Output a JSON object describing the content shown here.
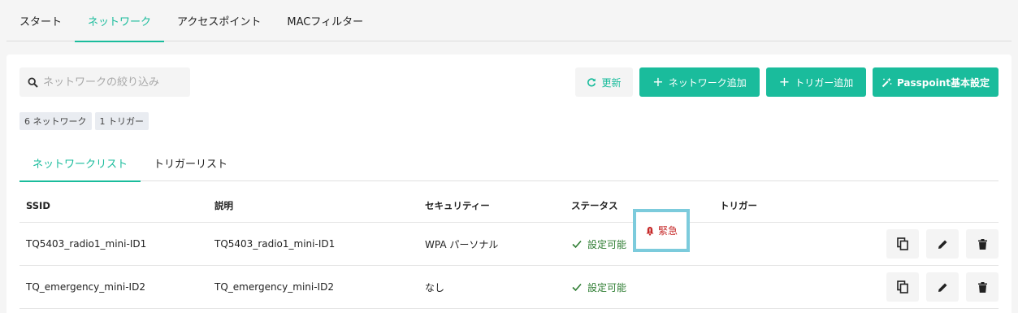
{
  "top_tabs": [
    "スタート",
    "ネットワーク",
    "アクセスポイント",
    "MACフィルター"
  ],
  "search": {
    "placeholder": "ネットワークの絞り込み"
  },
  "toolbar": {
    "refresh_label": "更新",
    "add_network_label": "ネットワーク追加",
    "add_trigger_label": "トリガー追加",
    "passpoint_label": "Passpoint基本設定"
  },
  "badges": {
    "networks": "6 ネットワーク",
    "triggers": "1 トリガー"
  },
  "sub_tabs": [
    "ネットワークリスト",
    "トリガーリスト"
  ],
  "table": {
    "columns": [
      "SSID",
      "説明",
      "セキュリティー",
      "ステータス",
      "トリガー"
    ],
    "rows": [
      {
        "ssid": "TQ5403_radio1_mini-ID1",
        "description": "TQ5403_radio1_mini-ID1",
        "security": "WPA パーソナル",
        "status": "設定可能",
        "trigger": ""
      },
      {
        "ssid": "TQ_emergency_mini-ID2",
        "description": "TQ_emergency_mini-ID2",
        "security": "なし",
        "status": "設定可能",
        "trigger": "緊急"
      }
    ]
  },
  "colors": {
    "accent": "#1abc9c",
    "status_ok": "#2e7d32",
    "emergency": "#c62828",
    "highlight_box": "#7ccbdc"
  }
}
